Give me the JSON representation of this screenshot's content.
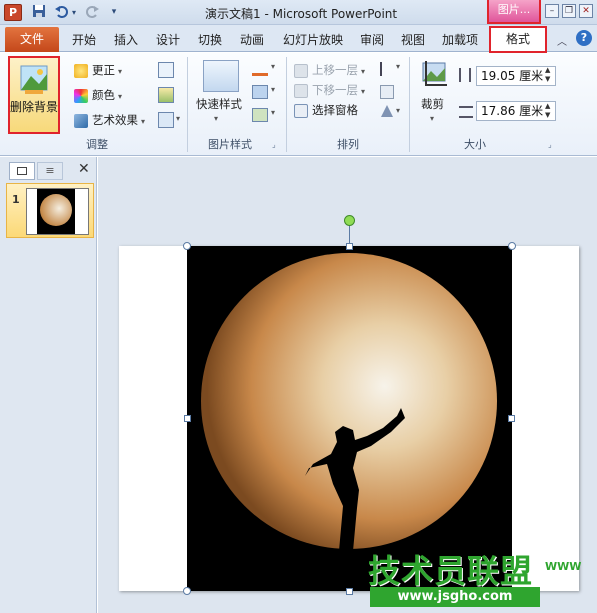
{
  "titlebar": {
    "app_logo": "P",
    "title": "演示文稿1 - Microsoft PowerPoint",
    "context_tab": "图片...",
    "icons": [
      "save-icon",
      "undo-icon",
      "redo-icon",
      "customize-qat-icon"
    ]
  },
  "tabs": {
    "file": "文件",
    "items": [
      "开始",
      "插入",
      "设计",
      "切换",
      "动画",
      "幻灯片放映",
      "审阅",
      "视图",
      "加载项"
    ],
    "format": "格式"
  },
  "ribbon": {
    "adjust": {
      "remove_bg": "删除背景",
      "corrections": "更正",
      "color": "颜色",
      "artistic": "艺术效果",
      "label": "调整"
    },
    "picture_styles": {
      "quick_styles": "快速样式",
      "label": "图片样式"
    },
    "arrange": {
      "bring_forward": "上移一层",
      "send_backward": "下移一层",
      "selection_pane": "选择窗格",
      "label": "排列"
    },
    "size": {
      "crop": "裁剪",
      "height": "19.05 厘米",
      "width": "17.86 厘米",
      "label": "大小"
    }
  },
  "left_pane": {
    "slide_number": "1"
  },
  "watermark": {
    "big": "技术员联盟",
    "small": "www.jsgho.com",
    "tag": "WWW"
  },
  "colors": {
    "file_tab": "#c4471a",
    "highlight": "#e0232c",
    "context_pink": "#e0559a",
    "watermark_green": "#2fa52f"
  }
}
